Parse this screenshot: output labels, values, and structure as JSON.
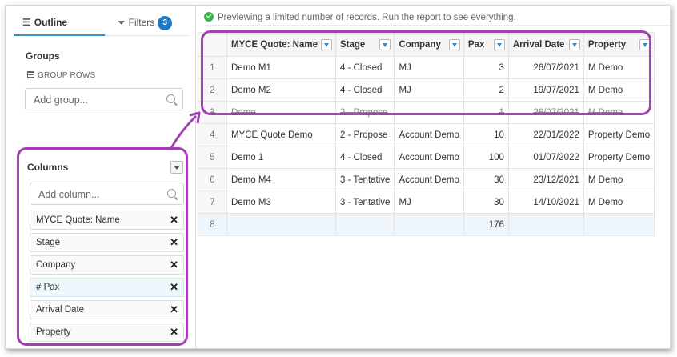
{
  "tabs": {
    "outline": "Outline",
    "filters": "Filters",
    "filters_count": "3"
  },
  "groups": {
    "title": "Groups",
    "group_rows_label": "GROUP ROWS",
    "add_placeholder": "Add group..."
  },
  "columns_panel": {
    "title": "Columns",
    "add_placeholder": "Add column...",
    "items": [
      {
        "label": "MYCE Quote: Name"
      },
      {
        "label": "Stage"
      },
      {
        "label": "Company"
      },
      {
        "label": "# Pax"
      },
      {
        "label": "Arrival Date"
      },
      {
        "label": "Property"
      }
    ]
  },
  "notice": "Previewing a limited number of records. Run the report to see everything.",
  "table": {
    "headers": [
      "MYCE Quote: Name",
      "Stage",
      "Company",
      "Pax",
      "Arrival Date",
      "Property"
    ],
    "rows": [
      {
        "n": "1",
        "name": "Demo M1",
        "stage": "4 - Closed",
        "company": "MJ",
        "pax": "3",
        "date": "26/07/2021",
        "property": "M Demo"
      },
      {
        "n": "2",
        "name": "Demo M2",
        "stage": "4 - Closed",
        "company": "MJ",
        "pax": "2",
        "date": "19/07/2021",
        "property": "M Demo"
      },
      {
        "n": "3",
        "name": "Demo",
        "stage": "2 - Propose",
        "company": "",
        "pax": "1",
        "date": "26/07/2021",
        "property": "M Demo"
      },
      {
        "n": "4",
        "name": "MYCE Quote Demo",
        "stage": "2 - Propose",
        "company": "Account Demo",
        "pax": "10",
        "date": "22/01/2022",
        "property": "Property Demo"
      },
      {
        "n": "5",
        "name": "Demo 1",
        "stage": "4 - Closed",
        "company": "Account Demo",
        "pax": "100",
        "date": "01/07/2022",
        "property": "Property Demo"
      },
      {
        "n": "6",
        "name": "Demo M4",
        "stage": "3 - Tentative",
        "company": "Account Demo",
        "pax": "30",
        "date": "23/12/2021",
        "property": "M Demo"
      },
      {
        "n": "7",
        "name": "Demo M3",
        "stage": "3 - Tentative",
        "company": "MJ",
        "pax": "30",
        "date": "14/10/2021",
        "property": "M Demo"
      }
    ],
    "total": {
      "n": "8",
      "pax": "176"
    }
  },
  "colors": {
    "annotation": "#a23fb3",
    "accent": "#1f78c4",
    "ok": "#3bb54a"
  },
  "icons": {
    "outline": "list-icon",
    "filters": "filter-icon",
    "group_rows": "rows-icon",
    "search": "search-icon",
    "remove": "close-icon",
    "column_menu": "chevron-down-icon",
    "notice": "check-circle-icon"
  }
}
